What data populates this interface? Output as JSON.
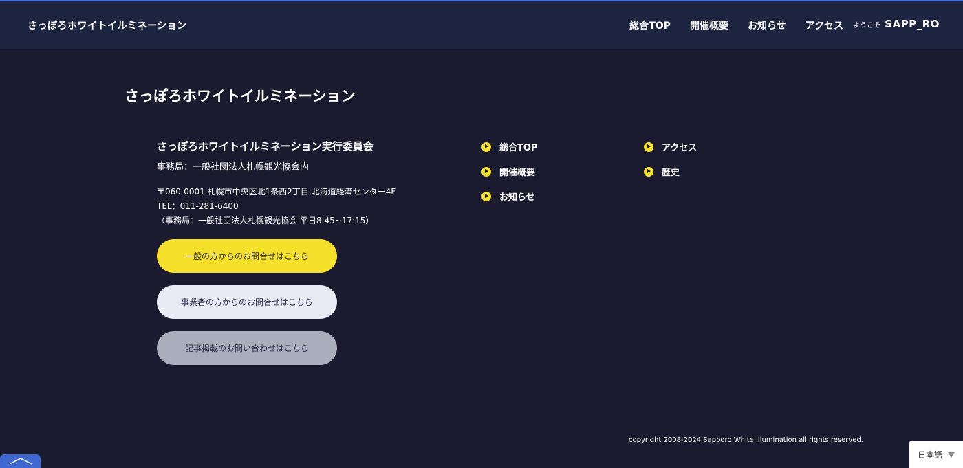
{
  "header": {
    "site_title": "さっぽろホワイトイルミネーション",
    "nav": [
      "総合TOP",
      "開催概要",
      "お知らせ",
      "アクセス"
    ],
    "logo_prefix": "ようこそ",
    "logo_main": "SAPP_RO"
  },
  "footer": {
    "title": "さっぽろホワイトイルミネーション",
    "org_name": "さっぽろホワイトイルミネーション実行委員会",
    "org_office": "事務局：一般社団法人札幌観光協会内",
    "address": "〒060-0001 札幌市中央区北1条西2丁目 北海道経済センター4F",
    "tel": "TEL：011-281-6400",
    "hours": "（事務局：一般社団法人札幌観光協会 平日8:45~17:15）",
    "buttons": {
      "general": "一般の方からのお問合せはこちら",
      "business": "事業者の方からのお問合せはこちら",
      "press": "記事掲載のお問い合わせはこちら"
    },
    "links_col1": [
      "総合TOP",
      "開催概要",
      "お知らせ"
    ],
    "links_col2": [
      "アクセス",
      "歴史"
    ],
    "copyright": "copyright 2008-2024 Sapporo White Illumination all rights reserved."
  },
  "language": {
    "selected": "日本語"
  },
  "colors": {
    "background": "#1a1b2e",
    "header": "#1c2440",
    "accent_yellow": "#f5e12a",
    "accent_blue": "#3e68cf"
  },
  "icons": {
    "page_top": "chevron-up-icon",
    "bullet": "play-circle-icon",
    "language_dropdown": "triangle-down-icon"
  }
}
